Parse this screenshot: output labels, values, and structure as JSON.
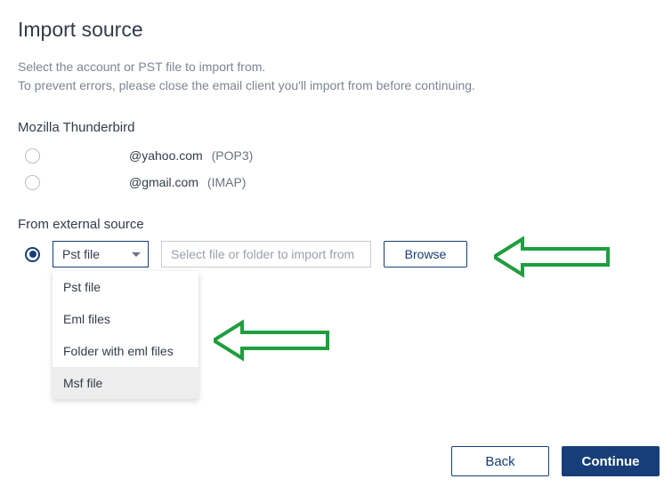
{
  "title": "Import source",
  "instructions_line1": "Select the account or PST file to import from.",
  "instructions_line2": "To prevent errors, please close the email client you'll import from before continuing.",
  "client_section_label": "Mozilla Thunderbird",
  "accounts": [
    {
      "email": "@yahoo.com",
      "protocol": "(POP3)"
    },
    {
      "email": "@gmail.com",
      "protocol": "(IMAP)"
    }
  ],
  "external_section_label": "From external source",
  "dropdown": {
    "selected": "Pst file",
    "options": [
      "Pst file",
      "Eml files",
      "Folder with eml files",
      "Msf file"
    ],
    "hovered_index": 3
  },
  "path_placeholder": "Select file or folder to import from",
  "browse_label": "Browse",
  "buttons": {
    "back": "Back",
    "continue": "Continue"
  },
  "colors": {
    "accent": "#173e78",
    "arrow": "#1e9e3e"
  }
}
